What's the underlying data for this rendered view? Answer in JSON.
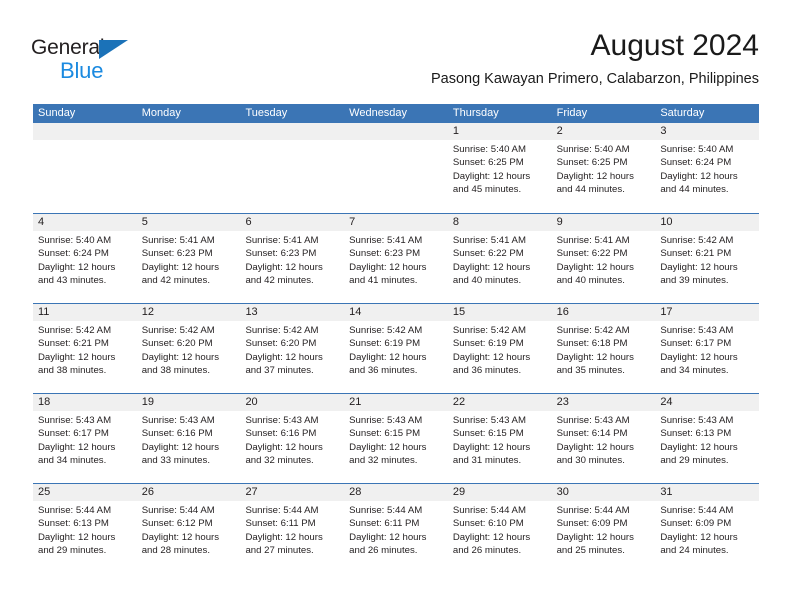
{
  "brand": {
    "name_top": "General",
    "name_bottom": "Blue",
    "color_dark": "#231f20",
    "color_blue": "#1b8ae0",
    "triangle_color": "#1b72b8"
  },
  "header": {
    "title": "August 2024",
    "subtitle": "Pasong Kawayan Primero, Calabarzon, Philippines"
  },
  "theme": {
    "header_blue": "#3b75b5",
    "date_band_gray": "#f0f0f0",
    "text_color": "#231f20"
  },
  "calendar": {
    "weekday_headers": [
      "Sunday",
      "Monday",
      "Tuesday",
      "Wednesday",
      "Thursday",
      "Friday",
      "Saturday"
    ],
    "weeks": [
      [
        {
          "day": "",
          "lines": []
        },
        {
          "day": "",
          "lines": []
        },
        {
          "day": "",
          "lines": []
        },
        {
          "day": "",
          "lines": []
        },
        {
          "day": "1",
          "lines": [
            "Sunrise: 5:40 AM",
            "Sunset: 6:25 PM",
            "Daylight: 12 hours",
            "and 45 minutes."
          ]
        },
        {
          "day": "2",
          "lines": [
            "Sunrise: 5:40 AM",
            "Sunset: 6:25 PM",
            "Daylight: 12 hours",
            "and 44 minutes."
          ]
        },
        {
          "day": "3",
          "lines": [
            "Sunrise: 5:40 AM",
            "Sunset: 6:24 PM",
            "Daylight: 12 hours",
            "and 44 minutes."
          ]
        }
      ],
      [
        {
          "day": "4",
          "lines": [
            "Sunrise: 5:40 AM",
            "Sunset: 6:24 PM",
            "Daylight: 12 hours",
            "and 43 minutes."
          ]
        },
        {
          "day": "5",
          "lines": [
            "Sunrise: 5:41 AM",
            "Sunset: 6:23 PM",
            "Daylight: 12 hours",
            "and 42 minutes."
          ]
        },
        {
          "day": "6",
          "lines": [
            "Sunrise: 5:41 AM",
            "Sunset: 6:23 PM",
            "Daylight: 12 hours",
            "and 42 minutes."
          ]
        },
        {
          "day": "7",
          "lines": [
            "Sunrise: 5:41 AM",
            "Sunset: 6:23 PM",
            "Daylight: 12 hours",
            "and 41 minutes."
          ]
        },
        {
          "day": "8",
          "lines": [
            "Sunrise: 5:41 AM",
            "Sunset: 6:22 PM",
            "Daylight: 12 hours",
            "and 40 minutes."
          ]
        },
        {
          "day": "9",
          "lines": [
            "Sunrise: 5:41 AM",
            "Sunset: 6:22 PM",
            "Daylight: 12 hours",
            "and 40 minutes."
          ]
        },
        {
          "day": "10",
          "lines": [
            "Sunrise: 5:42 AM",
            "Sunset: 6:21 PM",
            "Daylight: 12 hours",
            "and 39 minutes."
          ]
        }
      ],
      [
        {
          "day": "11",
          "lines": [
            "Sunrise: 5:42 AM",
            "Sunset: 6:21 PM",
            "Daylight: 12 hours",
            "and 38 minutes."
          ]
        },
        {
          "day": "12",
          "lines": [
            "Sunrise: 5:42 AM",
            "Sunset: 6:20 PM",
            "Daylight: 12 hours",
            "and 38 minutes."
          ]
        },
        {
          "day": "13",
          "lines": [
            "Sunrise: 5:42 AM",
            "Sunset: 6:20 PM",
            "Daylight: 12 hours",
            "and 37 minutes."
          ]
        },
        {
          "day": "14",
          "lines": [
            "Sunrise: 5:42 AM",
            "Sunset: 6:19 PM",
            "Daylight: 12 hours",
            "and 36 minutes."
          ]
        },
        {
          "day": "15",
          "lines": [
            "Sunrise: 5:42 AM",
            "Sunset: 6:19 PM",
            "Daylight: 12 hours",
            "and 36 minutes."
          ]
        },
        {
          "day": "16",
          "lines": [
            "Sunrise: 5:42 AM",
            "Sunset: 6:18 PM",
            "Daylight: 12 hours",
            "and 35 minutes."
          ]
        },
        {
          "day": "17",
          "lines": [
            "Sunrise: 5:43 AM",
            "Sunset: 6:17 PM",
            "Daylight: 12 hours",
            "and 34 minutes."
          ]
        }
      ],
      [
        {
          "day": "18",
          "lines": [
            "Sunrise: 5:43 AM",
            "Sunset: 6:17 PM",
            "Daylight: 12 hours",
            "and 34 minutes."
          ]
        },
        {
          "day": "19",
          "lines": [
            "Sunrise: 5:43 AM",
            "Sunset: 6:16 PM",
            "Daylight: 12 hours",
            "and 33 minutes."
          ]
        },
        {
          "day": "20",
          "lines": [
            "Sunrise: 5:43 AM",
            "Sunset: 6:16 PM",
            "Daylight: 12 hours",
            "and 32 minutes."
          ]
        },
        {
          "day": "21",
          "lines": [
            "Sunrise: 5:43 AM",
            "Sunset: 6:15 PM",
            "Daylight: 12 hours",
            "and 32 minutes."
          ]
        },
        {
          "day": "22",
          "lines": [
            "Sunrise: 5:43 AM",
            "Sunset: 6:15 PM",
            "Daylight: 12 hours",
            "and 31 minutes."
          ]
        },
        {
          "day": "23",
          "lines": [
            "Sunrise: 5:43 AM",
            "Sunset: 6:14 PM",
            "Daylight: 12 hours",
            "and 30 minutes."
          ]
        },
        {
          "day": "24",
          "lines": [
            "Sunrise: 5:43 AM",
            "Sunset: 6:13 PM",
            "Daylight: 12 hours",
            "and 29 minutes."
          ]
        }
      ],
      [
        {
          "day": "25",
          "lines": [
            "Sunrise: 5:44 AM",
            "Sunset: 6:13 PM",
            "Daylight: 12 hours",
            "and 29 minutes."
          ]
        },
        {
          "day": "26",
          "lines": [
            "Sunrise: 5:44 AM",
            "Sunset: 6:12 PM",
            "Daylight: 12 hours",
            "and 28 minutes."
          ]
        },
        {
          "day": "27",
          "lines": [
            "Sunrise: 5:44 AM",
            "Sunset: 6:11 PM",
            "Daylight: 12 hours",
            "and 27 minutes."
          ]
        },
        {
          "day": "28",
          "lines": [
            "Sunrise: 5:44 AM",
            "Sunset: 6:11 PM",
            "Daylight: 12 hours",
            "and 26 minutes."
          ]
        },
        {
          "day": "29",
          "lines": [
            "Sunrise: 5:44 AM",
            "Sunset: 6:10 PM",
            "Daylight: 12 hours",
            "and 26 minutes."
          ]
        },
        {
          "day": "30",
          "lines": [
            "Sunrise: 5:44 AM",
            "Sunset: 6:09 PM",
            "Daylight: 12 hours",
            "and 25 minutes."
          ]
        },
        {
          "day": "31",
          "lines": [
            "Sunrise: 5:44 AM",
            "Sunset: 6:09 PM",
            "Daylight: 12 hours",
            "and 24 minutes."
          ]
        }
      ]
    ]
  }
}
